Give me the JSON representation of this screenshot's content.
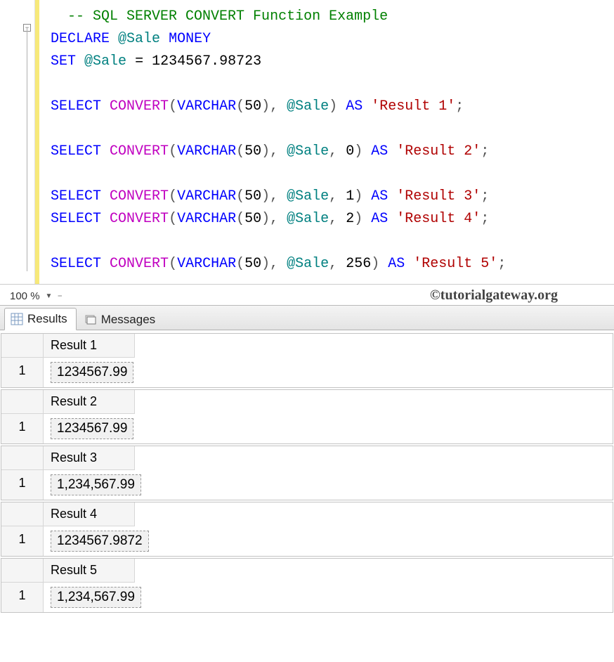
{
  "zoom": "100 %",
  "attribution": "©tutorialgateway.org",
  "tabs": {
    "results": "Results",
    "messages": "Messages"
  },
  "code": {
    "line1_comment": "-- SQL SERVER CONVERT Function Example",
    "declare": "DECLARE",
    "var": "@Sale",
    "money": "MONEY",
    "set": "SET",
    "eq": " = ",
    "val": "1234567.98723",
    "select": "SELECT",
    "convert": "CONVERT",
    "varchar": "VARCHAR",
    "n50": "50",
    "as": "AS",
    "r1": "'Result 1'",
    "r2": "'Result 2'",
    "r3": "'Result 3'",
    "r4": "'Result 4'",
    "r5": "'Result 5'",
    "p0": "0",
    "p1": "1",
    "p2": "2",
    "p256": "256"
  },
  "results": [
    {
      "header": "Result 1",
      "rownum": "1",
      "value": "1234567.99"
    },
    {
      "header": "Result 2",
      "rownum": "1",
      "value": "1234567.99"
    },
    {
      "header": "Result 3",
      "rownum": "1",
      "value": "1,234,567.99"
    },
    {
      "header": "Result 4",
      "rownum": "1",
      "value": "1234567.9872"
    },
    {
      "header": "Result 5",
      "rownum": "1",
      "value": "1,234,567.99"
    }
  ]
}
